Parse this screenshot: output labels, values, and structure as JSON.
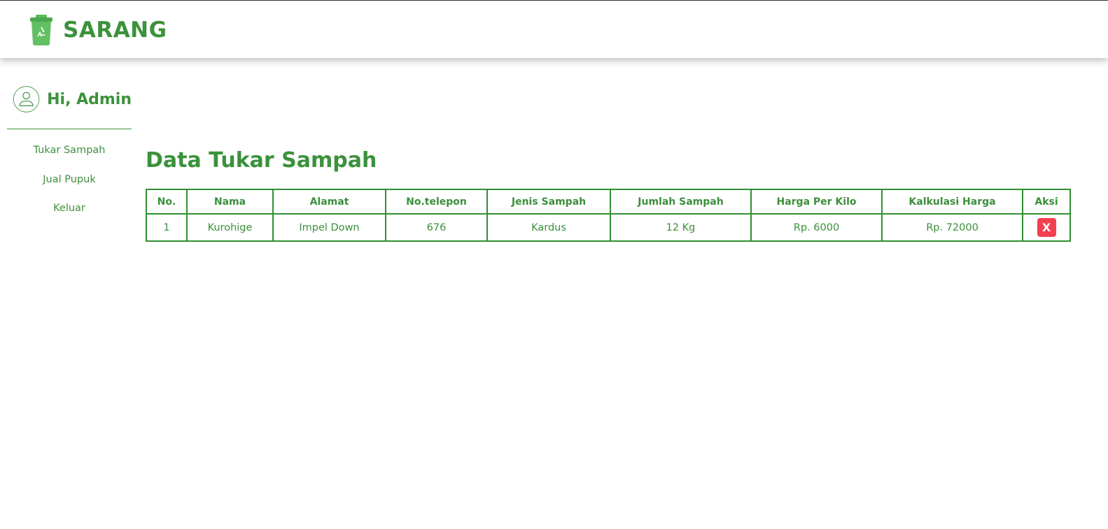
{
  "brand": {
    "title": "SARANG",
    "logo_icon": "recycle-bin-icon"
  },
  "sidebar": {
    "greeting": "Hi, Admin",
    "avatar_icon": "user-avatar-icon",
    "items": [
      {
        "label": "Tukar Sampah"
      },
      {
        "label": "Jual Pupuk"
      },
      {
        "label": "Keluar"
      }
    ]
  },
  "main": {
    "page_title": "Data Tukar Sampah",
    "table": {
      "headers": [
        "No.",
        "Nama",
        "Alamat",
        "No.telepon",
        "Jenis Sampah",
        "Jumlah Sampah",
        "Harga Per Kilo",
        "Kalkulasi Harga",
        "Aksi"
      ],
      "rows": [
        {
          "no": "1",
          "nama": "Kurohige",
          "alamat": "Impel Down",
          "telepon": "676",
          "jenis": "Kardus",
          "jumlah": "12 Kg",
          "harga_per_kilo": "Rp. 6000",
          "kalkulasi": "Rp. 72000",
          "aksi_label": "X"
        }
      ]
    }
  },
  "colors": {
    "accent_green": "#3b923b",
    "table_border": "#2f8f2f",
    "delete_red": "#f2404f"
  }
}
